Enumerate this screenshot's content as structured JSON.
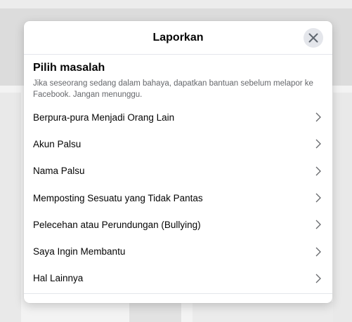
{
  "dialog": {
    "title": "Laporkan",
    "close_icon": "close-icon"
  },
  "section": {
    "heading": "Pilih masalah",
    "description": "Jika seseorang sedang dalam bahaya, dapatkan bantuan sebelum melapor ke Facebook. Jangan menunggu."
  },
  "options": [
    {
      "label": "Berpura-pura Menjadi Orang Lain",
      "icon": "chevron-right-icon"
    },
    {
      "label": "Akun Palsu",
      "icon": "chevron-right-icon"
    },
    {
      "label": "Nama Palsu",
      "icon": "chevron-right-icon"
    },
    {
      "label": "Memposting Sesuatu yang Tidak Pantas",
      "icon": "chevron-right-icon"
    },
    {
      "label": "Pelecehan atau Perundungan (Bullying)",
      "icon": "chevron-right-icon"
    },
    {
      "label": "Saya Ingin Membantu",
      "icon": "chevron-right-icon"
    },
    {
      "label": "Hal Lainnya",
      "icon": "chevron-right-icon"
    }
  ],
  "colors": {
    "close_button_bg": "#e4e6eb",
    "text_primary": "#050505",
    "text_secondary": "#65676b",
    "divider": "#e4e6eb"
  }
}
